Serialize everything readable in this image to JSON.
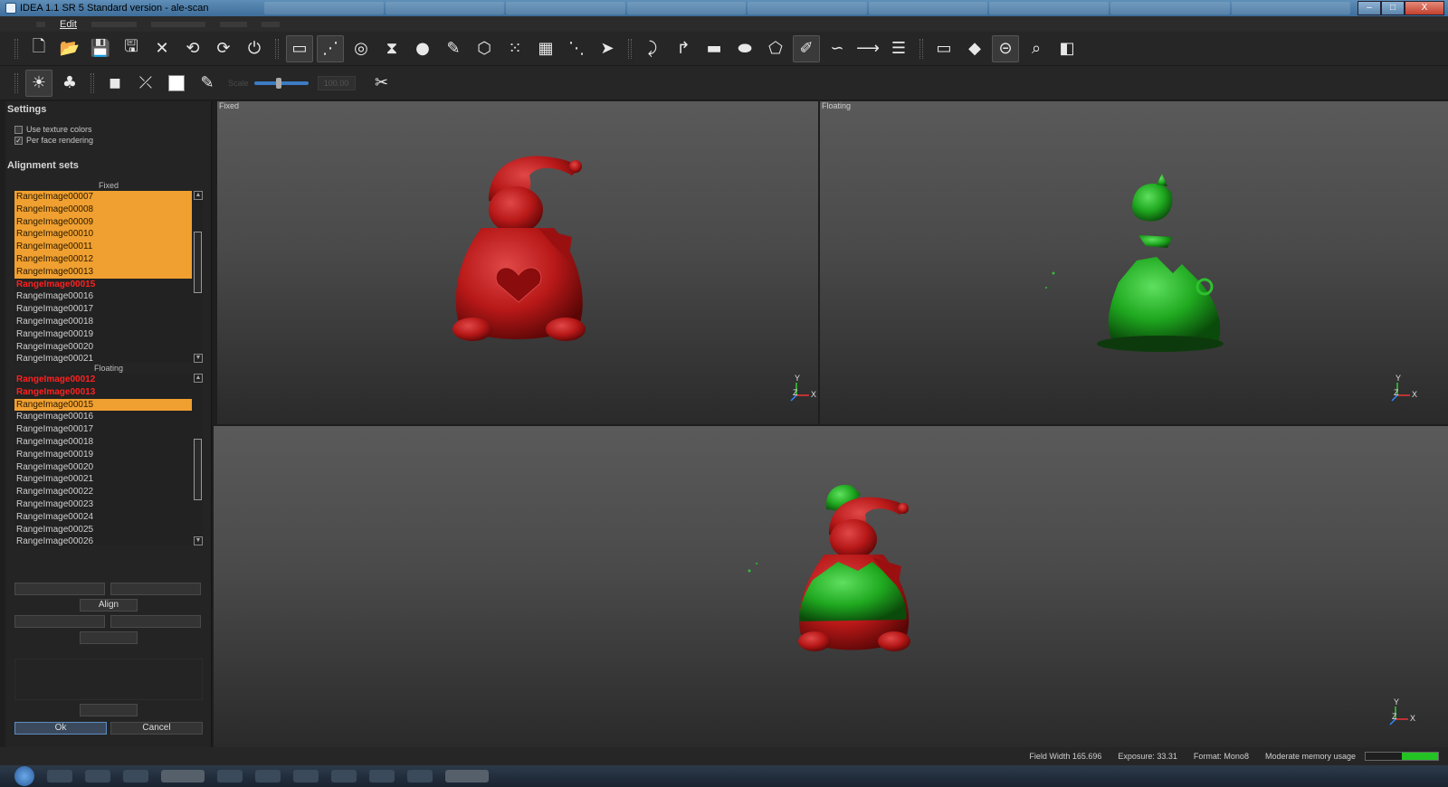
{
  "window": {
    "title": "IDEA 1.1 SR 5 Standard version - ale-scan"
  },
  "window_buttons": {
    "minimize": "–",
    "maximize": "□",
    "close": "X"
  },
  "menu": {
    "edit": "Edit"
  },
  "toolbar1": {
    "icons": [
      "new-file-icon",
      "open-folder-icon",
      "save-icon",
      "save-as-icon",
      "close-x-icon",
      "undo-icon",
      "redo-icon",
      "power-icon",
      "scanner-plane-icon",
      "curve-points-icon",
      "globe-mesh-icon",
      "merge-icon",
      "spheres-icon",
      "pins-icon",
      "hexagon-icon",
      "point-grid-icon",
      "grid-icon",
      "scatter-icon",
      "arrow-shape-icon",
      "hook-icon",
      "curve-arrow-icon",
      "rectangle-icon",
      "ellipse-icon",
      "polygon-icon",
      "freeform-icon",
      "line-dash-icon",
      "line-arrow-icon",
      "layers-icon",
      "window-icon",
      "pin-small-icon",
      "disc-icon",
      "zoom-icon",
      "cube-icon"
    ],
    "glyphs": [
      "🗋",
      "📂",
      "💾",
      "🖫",
      "✕",
      "⟲",
      "⟳",
      "⏻",
      "▭",
      "⋰",
      "◎",
      "⧗",
      "●",
      "✎",
      "⬡",
      "⁙",
      "▦",
      "⋱",
      "➤",
      "⤸",
      "↱",
      "▬",
      "⬬",
      "⬠",
      "✐",
      "∽",
      "⟶",
      "☰",
      "▭",
      "◆",
      "⊝",
      "⌕",
      "◧"
    ]
  },
  "toolbar2": {
    "glyphs": [
      "☀",
      "♣",
      "■",
      "⤫",
      "□",
      "✎",
      "✂"
    ],
    "scale_label": "Scale",
    "scale_value": "100.00",
    "opacity_fraction": 0.45
  },
  "sidebar": {
    "settings_title": "Settings",
    "use_texture_colors": "Use texture colors",
    "use_texture_colors_checked": false,
    "per_face_rendering": "Per face rendering",
    "per_face_rendering_checked": true,
    "alignment_sets_title": "Alignment sets",
    "fixed_title": "Fixed",
    "floating_title": "Floating",
    "fixed_items": [
      {
        "label": "RangeImage00007",
        "state": "sel"
      },
      {
        "label": "RangeImage00008",
        "state": "sel"
      },
      {
        "label": "RangeImage00009",
        "state": "sel"
      },
      {
        "label": "RangeImage00010",
        "state": "sel"
      },
      {
        "label": "RangeImage00011",
        "state": "sel"
      },
      {
        "label": "RangeImage00012",
        "state": "sel"
      },
      {
        "label": "RangeImage00013",
        "state": "sel"
      },
      {
        "label": "RangeImage00015",
        "state": "red"
      },
      {
        "label": "RangeImage00016",
        "state": ""
      },
      {
        "label": "RangeImage00017",
        "state": ""
      },
      {
        "label": "RangeImage00018",
        "state": ""
      },
      {
        "label": "RangeImage00019",
        "state": ""
      },
      {
        "label": "RangeImage00020",
        "state": ""
      },
      {
        "label": "RangeImage00021",
        "state": ""
      }
    ],
    "floating_items": [
      {
        "label": "RangeImage00012",
        "state": "red"
      },
      {
        "label": "RangeImage00013",
        "state": "red"
      },
      {
        "label": "RangeImage00015",
        "state": "sel"
      },
      {
        "label": "RangeImage00016",
        "state": ""
      },
      {
        "label": "RangeImage00017",
        "state": ""
      },
      {
        "label": "RangeImage00018",
        "state": ""
      },
      {
        "label": "RangeImage00019",
        "state": ""
      },
      {
        "label": "RangeImage00020",
        "state": ""
      },
      {
        "label": "RangeImage00021",
        "state": ""
      },
      {
        "label": "RangeImage00022",
        "state": ""
      },
      {
        "label": "RangeImage00023",
        "state": ""
      },
      {
        "label": "RangeImage00024",
        "state": ""
      },
      {
        "label": "RangeImage00025",
        "state": ""
      },
      {
        "label": "RangeImage00026",
        "state": ""
      }
    ],
    "align_button": "Align",
    "ok_button": "Ok",
    "cancel_button": "Cancel"
  },
  "viewports": {
    "fixed_label": "Fixed",
    "floating_label": "Floating",
    "axis_y": "Y",
    "axis_z": "Z",
    "axis_x": "X"
  },
  "colors": {
    "fixed_model": "#b81818",
    "floating_model": "#1fa81f",
    "selection": "#f0a030",
    "highlight_red": "#ff2020"
  },
  "status": {
    "field_width": "Field Width 165.696",
    "exposure": "Exposure: 33.31",
    "format": "Format: Mono8",
    "memory": "Moderate memory usage",
    "memory_fraction": 0.5
  }
}
